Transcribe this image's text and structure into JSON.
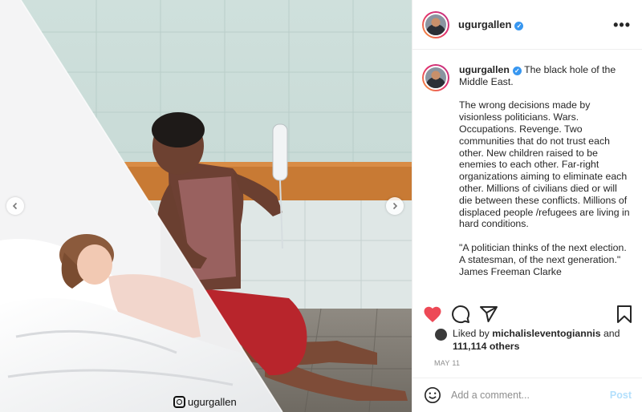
{
  "post": {
    "username": "ugurgallen",
    "verified_mark": "✓",
    "more_label": "•••",
    "watermark": "ugurgallen",
    "caption": {
      "username": "ugurgallen",
      "paragraphs": [
        "The black hole of the Middle East.",
        "The wrong decisions made by visionless politicians. Wars. Occupations. Revenge. Two communities that do not trust each other. New children raised to be enemies to each other. Far-right organizations aiming to eliminate each other. Millions of civilians died or will die between these conflicts. Millions of displaced people /refugees are living in hard conditions.",
        "\"A politician thinks of the next election. A statesman, of the next generation.\" James Freeman Clarke"
      ]
    },
    "likes": {
      "prefix": "Liked by",
      "liker": "michalisleventogiannis",
      "middle": "and",
      "count": "111,114 others"
    },
    "date": "MAY 11",
    "comment": {
      "placeholder": "Add a comment...",
      "post_label": "Post"
    },
    "icons": {
      "like": "heart-icon",
      "comment": "comment-icon",
      "share": "share-icon",
      "save": "bookmark-icon",
      "emoji": "emoji-icon",
      "prev": "chevron-left-icon",
      "next": "chevron-right-icon",
      "watermark": "instagram-icon"
    },
    "colors": {
      "like_active": "#ed4956",
      "verified": "#3897f0",
      "post_disabled": "#b2dffc"
    }
  }
}
